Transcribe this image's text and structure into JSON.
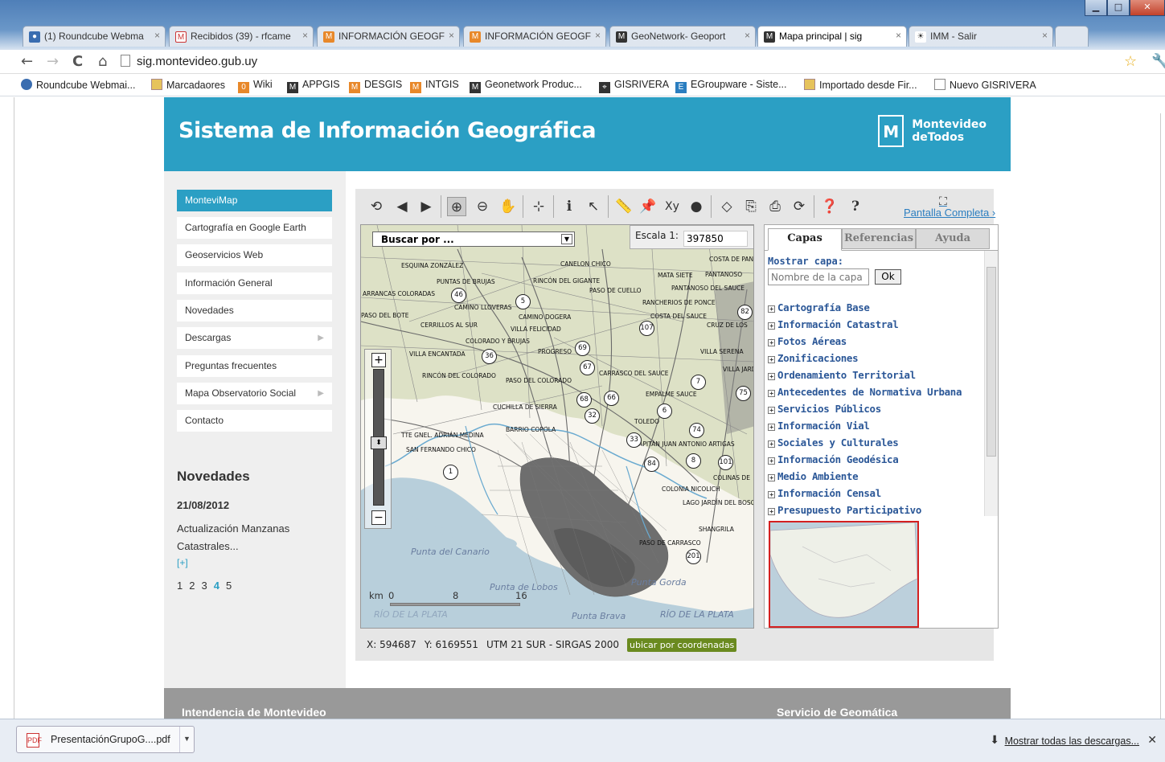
{
  "browser": {
    "tabs": [
      {
        "title": "(1) Roundcube Webma",
        "icon": "roundcube-icon"
      },
      {
        "title": "Recibidos (39) - rfcame",
        "icon": "gmail-icon"
      },
      {
        "title": "INFORMACIÓN GEOGF",
        "icon": "imm-icon"
      },
      {
        "title": "INFORMACIÓN GEOGF",
        "icon": "imm-icon"
      },
      {
        "title": "GeoNetwork- Geoport",
        "icon": "imm-icon"
      },
      {
        "title": "Mapa principal | sig",
        "icon": "imm-icon"
      },
      {
        "title": "IMM - Salir",
        "icon": "imm-logo-icon"
      }
    ],
    "url": "sig.montevideo.gub.uy",
    "bookmarks": [
      "Roundcube Webmai...",
      "Marcadaores",
      "Wiki",
      "APPGIS",
      "DESGIS",
      "INTGIS",
      "Geonetwork Produc...",
      "GISRIVERA",
      "EGroupware - Siste...",
      "Importado desde Fir...",
      "Nuevo GISRIVERA"
    ]
  },
  "header": {
    "title": "Sistema de Información Geográfica",
    "logo_line1": "Montevideo",
    "logo_line2": "deTodos"
  },
  "sidebar": {
    "items": [
      {
        "label": "MonteviMap",
        "active": true
      },
      {
        "label": "Cartografía en Google Earth"
      },
      {
        "label": "Geoservicios Web"
      },
      {
        "label": "Información General"
      },
      {
        "label": "Novedades"
      },
      {
        "label": "Descargas",
        "submenu": true
      },
      {
        "label": "Preguntas frecuentes"
      },
      {
        "label": "Mapa Observatorio Social",
        "submenu": true
      },
      {
        "label": "Contacto"
      }
    ],
    "news": {
      "title": "Novedades",
      "date": "21/08/2012",
      "text": "Actualización Manzanas Catastrales...",
      "more": "[+]",
      "pages": [
        "1",
        "2",
        "3",
        "4",
        "5"
      ],
      "current_page": "4"
    }
  },
  "map": {
    "fullscreen_label": "Pantalla Completa",
    "search_label": "Buscar por ...",
    "scale_label": "Escala 1:",
    "scale_value": "397850",
    "scalebar": {
      "unit": "km",
      "ticks": [
        "0",
        "8",
        "16"
      ]
    },
    "coords": {
      "x_label": "X: 594687",
      "y_label": "Y: 6169551",
      "projection": "UTM 21 SUR - SIRGAS 2000",
      "locate_button": "ubicar por coordenadas"
    },
    "places": [
      "ESQUINA ZONZÁLEZ",
      "CANELON CHICO",
      "COSTA DE PAN",
      "MATA SIETE",
      "PANTANOSO",
      "PUNTAS DE BRUJAS",
      "RINCÓN DEL GIGANTE",
      "PASO DE CUELLO",
      "PANTANOSO DEL SAUCE",
      "ARRANCAS COLORADAS",
      "CAMINO LLOVERAS",
      "RANCHERIOS DE PONCE",
      "PASO DEL BOTE",
      "CAMINO DOGERA",
      "COSTA DEL SAUCE",
      "CERRILLOS AL SUR",
      "VILLA FELICIDAD",
      "CRUZ DE LOS",
      "COLORADO Y BRUJAS",
      "VILLA SERENA",
      "VILLA ENCANTADA",
      "PROGRESO",
      "VILLA JARDÍN",
      "RINCÓN DEL COLORADO",
      "PASO DEL COLORADO",
      "CARRASCO DEL SAUCE",
      "EMPALME SAUCE",
      "CUCHILLA DE SIERRA",
      "BARRIO COPOLA",
      "TOLEDO",
      "TTE GNEL. ADRIÁN MEDINA",
      "SAN FERNANDO CHICO",
      "CAPITÁN JUAN ANTONIO ARTIGAS",
      "COLINAS DE",
      "COLONIA NICOLICH",
      "LAGO JARDÍN DEL BOSQUE",
      "SHANGRILA",
      "PASO DE CARRASCO"
    ],
    "routes": [
      "46",
      "5",
      "82",
      "107",
      "36",
      "69",
      "67",
      "7",
      "75",
      "68",
      "66",
      "32",
      "6",
      "74",
      "33",
      "8",
      "101",
      "84",
      "1",
      "201"
    ],
    "water_labels": [
      "Punta del Canario",
      "Punta de Lobos",
      "Punta Gorda",
      "Punta Brava",
      "RÍO DE LA PLATA",
      "RÍO DE LA PLATA"
    ]
  },
  "panel": {
    "tabs": [
      "Capas",
      "Referencias",
      "Ayuda"
    ],
    "active_tab": "Capas",
    "show_layer_label": "Mostrar capa:",
    "layer_placeholder": "Nombre de la capa",
    "ok_label": "Ok",
    "layers": [
      "Cartografía Base",
      "Información Catastral",
      "Fotos Aéreas",
      "Zonificaciones",
      "Ordenamiento Territorial",
      "Antecedentes de Normativa Urbana",
      "Servicios Públicos",
      "Información Vial",
      "Sociales y Culturales",
      "Información Geodésica",
      "Medio Ambiente",
      "Información Censal",
      "Presupuesto Participativo"
    ]
  },
  "footer": {
    "left": "Intendencia de Montevideo",
    "right": "Servicio de Geomática"
  },
  "downloads": {
    "file": "PresentaciónGrupoG....pdf",
    "show_all": "Mostrar todas las descargas..."
  },
  "colors": {
    "brand": "#2b9fc4",
    "layer_link": "#2b5797",
    "minimap_border": "#d42020",
    "locate_button": "#6a8a1f"
  }
}
